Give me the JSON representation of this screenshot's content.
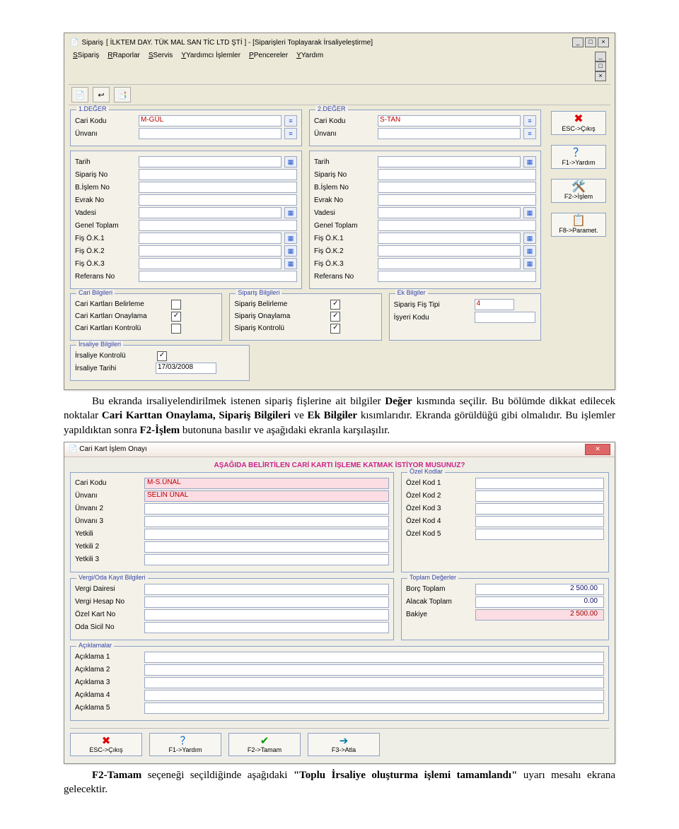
{
  "shot1": {
    "title_app": "Sipariş",
    "title_company": "[ İLKTEM DAY. TÜK MAL SAN TİC LTD ŞTİ ]  -  [Siparişleri Toplayarak İrsaliyeleştirme]",
    "menus": [
      "Sipariş",
      "Raporlar",
      "Servis",
      "Yardımcı İşlemler",
      "Pencereler",
      "Yardım"
    ],
    "menus_u": [
      "S",
      "R",
      "S",
      "Y",
      "P",
      "Y"
    ],
    "side": {
      "esc": "ESC->Çıkış",
      "f1": "F1->Yardım",
      "f2": "F2->İşlem",
      "f8": "F8->Paramet."
    },
    "grp1": {
      "legendA": "1.DEĞER",
      "legendB": "2.DEĞER",
      "lbl_cari": "Cari Kodu",
      "lbl_unvan": "Ünvanı",
      "valA": "M-GÜL",
      "valB": "S-TAN"
    },
    "rows": [
      "Tarih",
      "Sipariş No",
      "B.İşlem No",
      "Evrak No",
      "Vadesi",
      "Genel Toplam",
      "Fiş Ö.K.1",
      "Fiş Ö.K.2",
      "Fiş Ö.K.3",
      "Referans No"
    ],
    "fs_cari": {
      "legend": "Cari Bilgileri",
      "r1": "Cari Kartları Belirleme",
      "r2": "Cari Kartları Onaylama",
      "r3": "Cari Kartları Kontrolü",
      "c1": "",
      "c2": "✓",
      "c3": ""
    },
    "fs_sip": {
      "legend": "Sipariş Bilgileri",
      "r1": "Sipariş Belirleme",
      "r2": "Sipariş Onaylama",
      "r3": "Sipariş Kontrolü",
      "c1": "✓",
      "c2": "✓",
      "c3": "✓"
    },
    "fs_ek": {
      "legend": "Ek Bilgiler",
      "r1": "Sipariş Fiş Tipi",
      "v1": "4",
      "r2": "İşyeri Kodu"
    },
    "fs_irs": {
      "legend": "İrsaliye Bilgileri",
      "r1": "İrsaliye Kontrolü",
      "c1": "✓",
      "r2": "İrsaliye Tarihi",
      "v2": "17/03/2008"
    }
  },
  "para1a": "Bu ekranda irsaliyelendirilmek istenen sipariş fişlerine ait bilgiler ",
  "para1b": "Değer",
  "para1c": " kısmında seçilir. Bu bölümde dikkat edilecek noktalar ",
  "para1d": "Cari Karttan Onaylama, Sipariş Bilgileri",
  "para1e": " ve ",
  "para1f": "Ek Bilgiler",
  "para1g": " kısımlarıdır. Ekranda görüldüğü gibi olmalıdır. Bu işlemler yapıldıktan sonra ",
  "para1h": "F2-İşlem",
  "para1i": " butonuna basılır ve aşağıdaki ekranla karşılaşılır.",
  "shot2": {
    "wintitle": "Cari Kart İşlem Onayı",
    "question": "AŞAĞIDA BELİRTİLEN CARİ KARTI İŞLEME KATMAK İSTİYOR MUSUNUZ?",
    "leftmain": {
      "l1": "Cari Kodu",
      "v1": "M-S.ÜNAL",
      "l2": "Ünvanı",
      "v2": "SELİN ÜNAL",
      "l3": "Ünvanı 2",
      "l4": "Ünvanı 3",
      "l5": "Yetkili",
      "l6": "Yetkili 2",
      "l7": "Yetkili 3"
    },
    "ozel": {
      "legend": "Özel Kodlar",
      "l1": "Özel Kod 1",
      "l2": "Özel Kod 2",
      "l3": "Özel Kod 3",
      "l4": "Özel Kod 4",
      "l5": "Özel Kod 5"
    },
    "vergi": {
      "legend": "Vergi/Oda Kayıt Bilgileri",
      "l1": "Vergi Dairesi",
      "l2": "Vergi Hesap No",
      "l3": "Özel Kart No",
      "l4": "Oda Sicil No"
    },
    "toplam": {
      "legend": "Toplam Değerler",
      "l1": "Borç Toplam",
      "v1": "2 500.00",
      "l2": "Alacak Toplam",
      "v2": "0.00",
      "l3": "Bakiye",
      "v3": "2 500.00"
    },
    "acik": {
      "legend": "Açıklamalar",
      "l1": "Açıklama 1",
      "l2": "Açıklama 2",
      "l3": "Açıklama 3",
      "l4": "Açıklama 4",
      "l5": "Açıklama 5"
    },
    "btns": {
      "b1": "ESC->Çıkış",
      "b2": "F1->Yardım",
      "b3": "F2->Tamam",
      "b4": "F3->Atla"
    }
  },
  "para2a": "F2-Tamam",
  "para2b": " seçeneği seçildiğinde aşağıdaki ",
  "para2c": "\"Toplu İrsaliye oluşturma işlemi tamamlandı\"",
  "para2d": " uyarı mesahı ekrana gelecektir."
}
